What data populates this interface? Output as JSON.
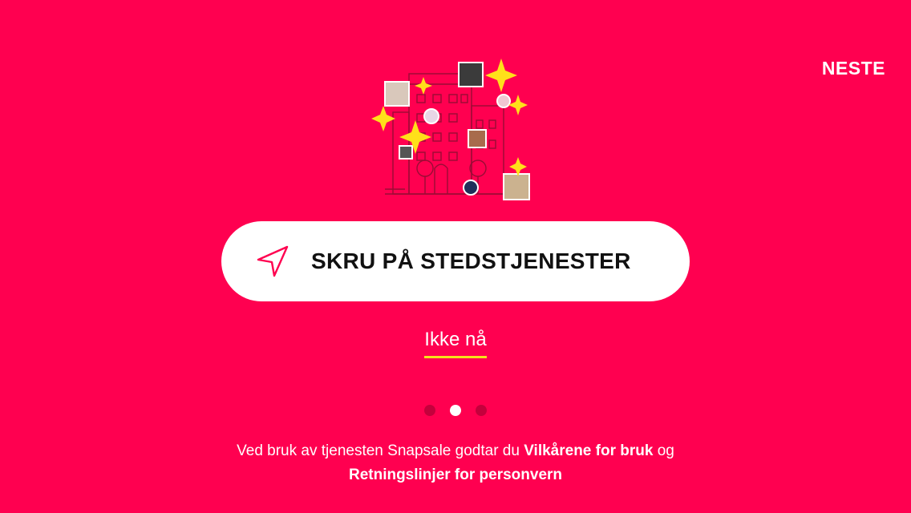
{
  "header": {
    "next_label": "NESTE"
  },
  "main": {
    "location_button_label": "SKRU PÅ STEDSTJENESTER",
    "not_now_label": "Ikke nå",
    "pagination": {
      "current": 2,
      "total": 3
    }
  },
  "footer": {
    "terms_prefix": "Ved bruk av tjenesten Snapsale godtar du ",
    "terms_link": "Vilkårene for bruk",
    "terms_and": " og ",
    "privacy_link": "Retningslinjer for personvern"
  },
  "colors": {
    "background": "#ff0050",
    "button_background": "#ffffff",
    "underline": "#f5e21a",
    "sparkle": "#ffe01a"
  },
  "icons": [
    "navigation-arrow-icon",
    "sparkle-icon"
  ]
}
